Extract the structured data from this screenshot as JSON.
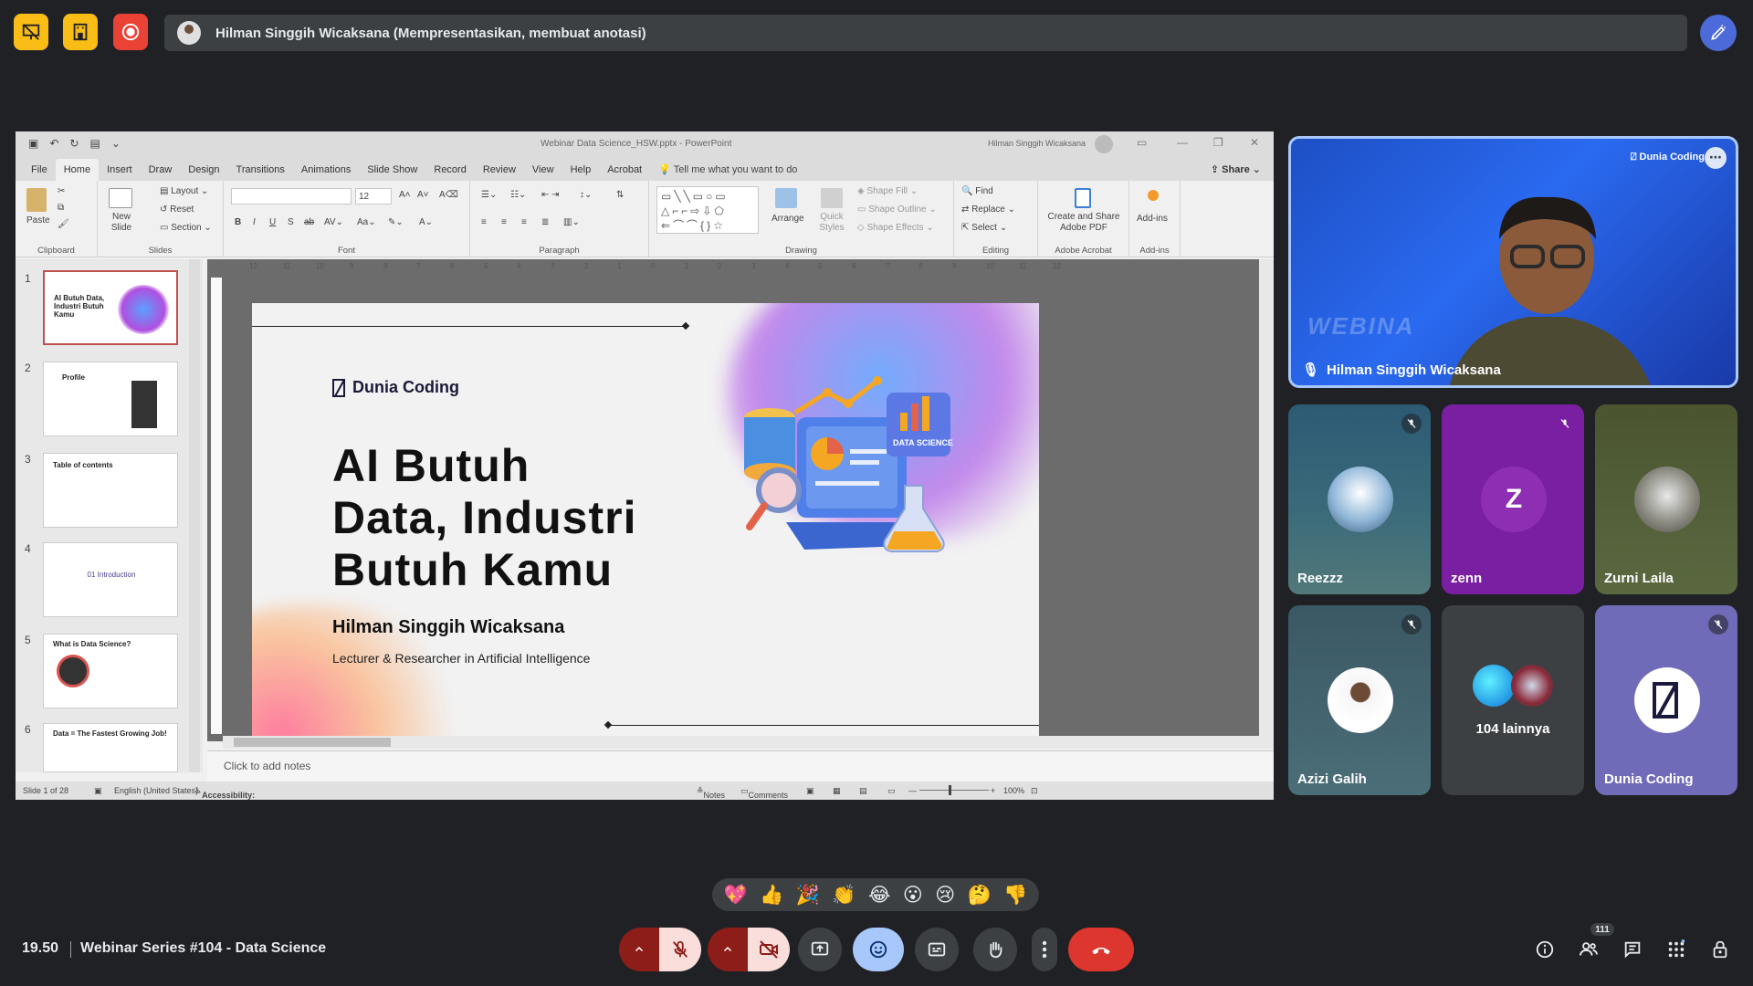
{
  "top_bar": {
    "presenting_text": "Hilman Singgih Wicaksana (Mempresentasikan, membuat anotasi)",
    "icons": [
      "presentation-off-icon",
      "building-icon",
      "record-icon",
      "annotate-pen-icon"
    ],
    "colors": {
      "yellow_button": "#f9bd16",
      "record_button": "#ea4335",
      "annotate": "#4c6bd8"
    }
  },
  "ppt": {
    "file_title": "Webinar Data Science_HSW.pptx  -  PowerPoint",
    "user_name": "Hilman Singgih Wicaksana",
    "menu_tabs": [
      "File",
      "Home",
      "Insert",
      "Draw",
      "Design",
      "Transitions",
      "Animations",
      "Slide Show",
      "Record",
      "Review",
      "View",
      "Help",
      "Acrobat"
    ],
    "tell_me": "Tell me what you want to do",
    "share": "Share",
    "ribbon": {
      "paste": "Paste",
      "new_slide": "New Slide",
      "layout": "Layout",
      "reset": "Reset",
      "section": "Section",
      "font_size": "12",
      "arrange": "Arrange",
      "quick_styles": "Quick Styles",
      "shape_fill": "Shape Fill",
      "shape_outline": "Shape Outline",
      "shape_effects": "Shape Effects",
      "find": "Find",
      "replace": "Replace",
      "select": "Select",
      "create_share_pdf": "Create and Share Adobe PDF",
      "addins": "Add-ins",
      "groups": {
        "clipboard": "Clipboard",
        "slides": "Slides",
        "font": "Font",
        "paragraph": "Paragraph",
        "drawing": "Drawing",
        "editing": "Editing",
        "adobe": "Adobe Acrobat",
        "addins": "Add-ins"
      }
    },
    "ruler_labels": [
      "12",
      "11",
      "10",
      "9",
      "8",
      "7",
      "6",
      "5",
      "4",
      "3",
      "2",
      "1",
      "0",
      "1",
      "2",
      "3",
      "4",
      "5",
      "6",
      "7",
      "8",
      "9",
      "10",
      "11",
      "12"
    ],
    "thumbnails": [
      {
        "num": "1",
        "title": "AI Butuh Data, Industri Butuh Kamu"
      },
      {
        "num": "2",
        "title": "Profile"
      },
      {
        "num": "3",
        "title": "Table of contents"
      },
      {
        "num": "4",
        "title": "01 Introduction"
      },
      {
        "num": "5",
        "title": "What is Data Science?"
      },
      {
        "num": "6",
        "title": "Data = The Fastest Growing Job!"
      }
    ],
    "slide": {
      "brand": "Dunia Coding",
      "title_line1": "AI Butuh",
      "title_line2": "Data, Industri",
      "title_line3": "Butuh Kamu",
      "speaker": "Hilman Singgih Wicaksana",
      "role": "Lecturer & Researcher in Artificial Intelligence",
      "illustration_label": "DATA SCIENCE"
    },
    "notes_placeholder": "Click to add notes",
    "status": {
      "slide_of": "Slide 1 of 28",
      "language": "English (United States)",
      "accessibility": "Accessibility: Investigate",
      "notes": "Notes",
      "comments": "Comments",
      "zoom": "100%"
    }
  },
  "participants": {
    "speaker": {
      "name": "Hilman Singgih Wicaksana",
      "watermark": "WEBINA",
      "logo": "Dunia Coding"
    },
    "tiles": [
      {
        "name": "Reezzz",
        "muted": true,
        "bg": "#2e4a5a"
      },
      {
        "name": "zenn",
        "initial": "Z",
        "muted": true,
        "bg": "#7b2a8f"
      },
      {
        "name": "Zurni Laila",
        "muted": false,
        "bg": "#4f5a35"
      },
      {
        "name": "Azizi Galih",
        "muted": true,
        "bg": "#3c5a66"
      },
      {
        "name": "104 lainnya",
        "muted": false,
        "bg": "#3c4043"
      },
      {
        "name": "Dunia Coding",
        "muted": true,
        "bg": "#6f6bb8"
      }
    ]
  },
  "reactions": [
    "💖",
    "👍",
    "🎉",
    "👏",
    "😂",
    "😮",
    "😢",
    "🤔",
    "👎"
  ],
  "bottom_bar": {
    "time": "19.50",
    "meeting_title": "Webinar Series #104 - Data Science",
    "participant_count": "111",
    "controls": [
      "mic-off-icon",
      "camera-off-icon",
      "present-icon",
      "emoji-icon",
      "captions-icon",
      "raise-hand-icon",
      "more-icon",
      "end-call-icon"
    ]
  }
}
